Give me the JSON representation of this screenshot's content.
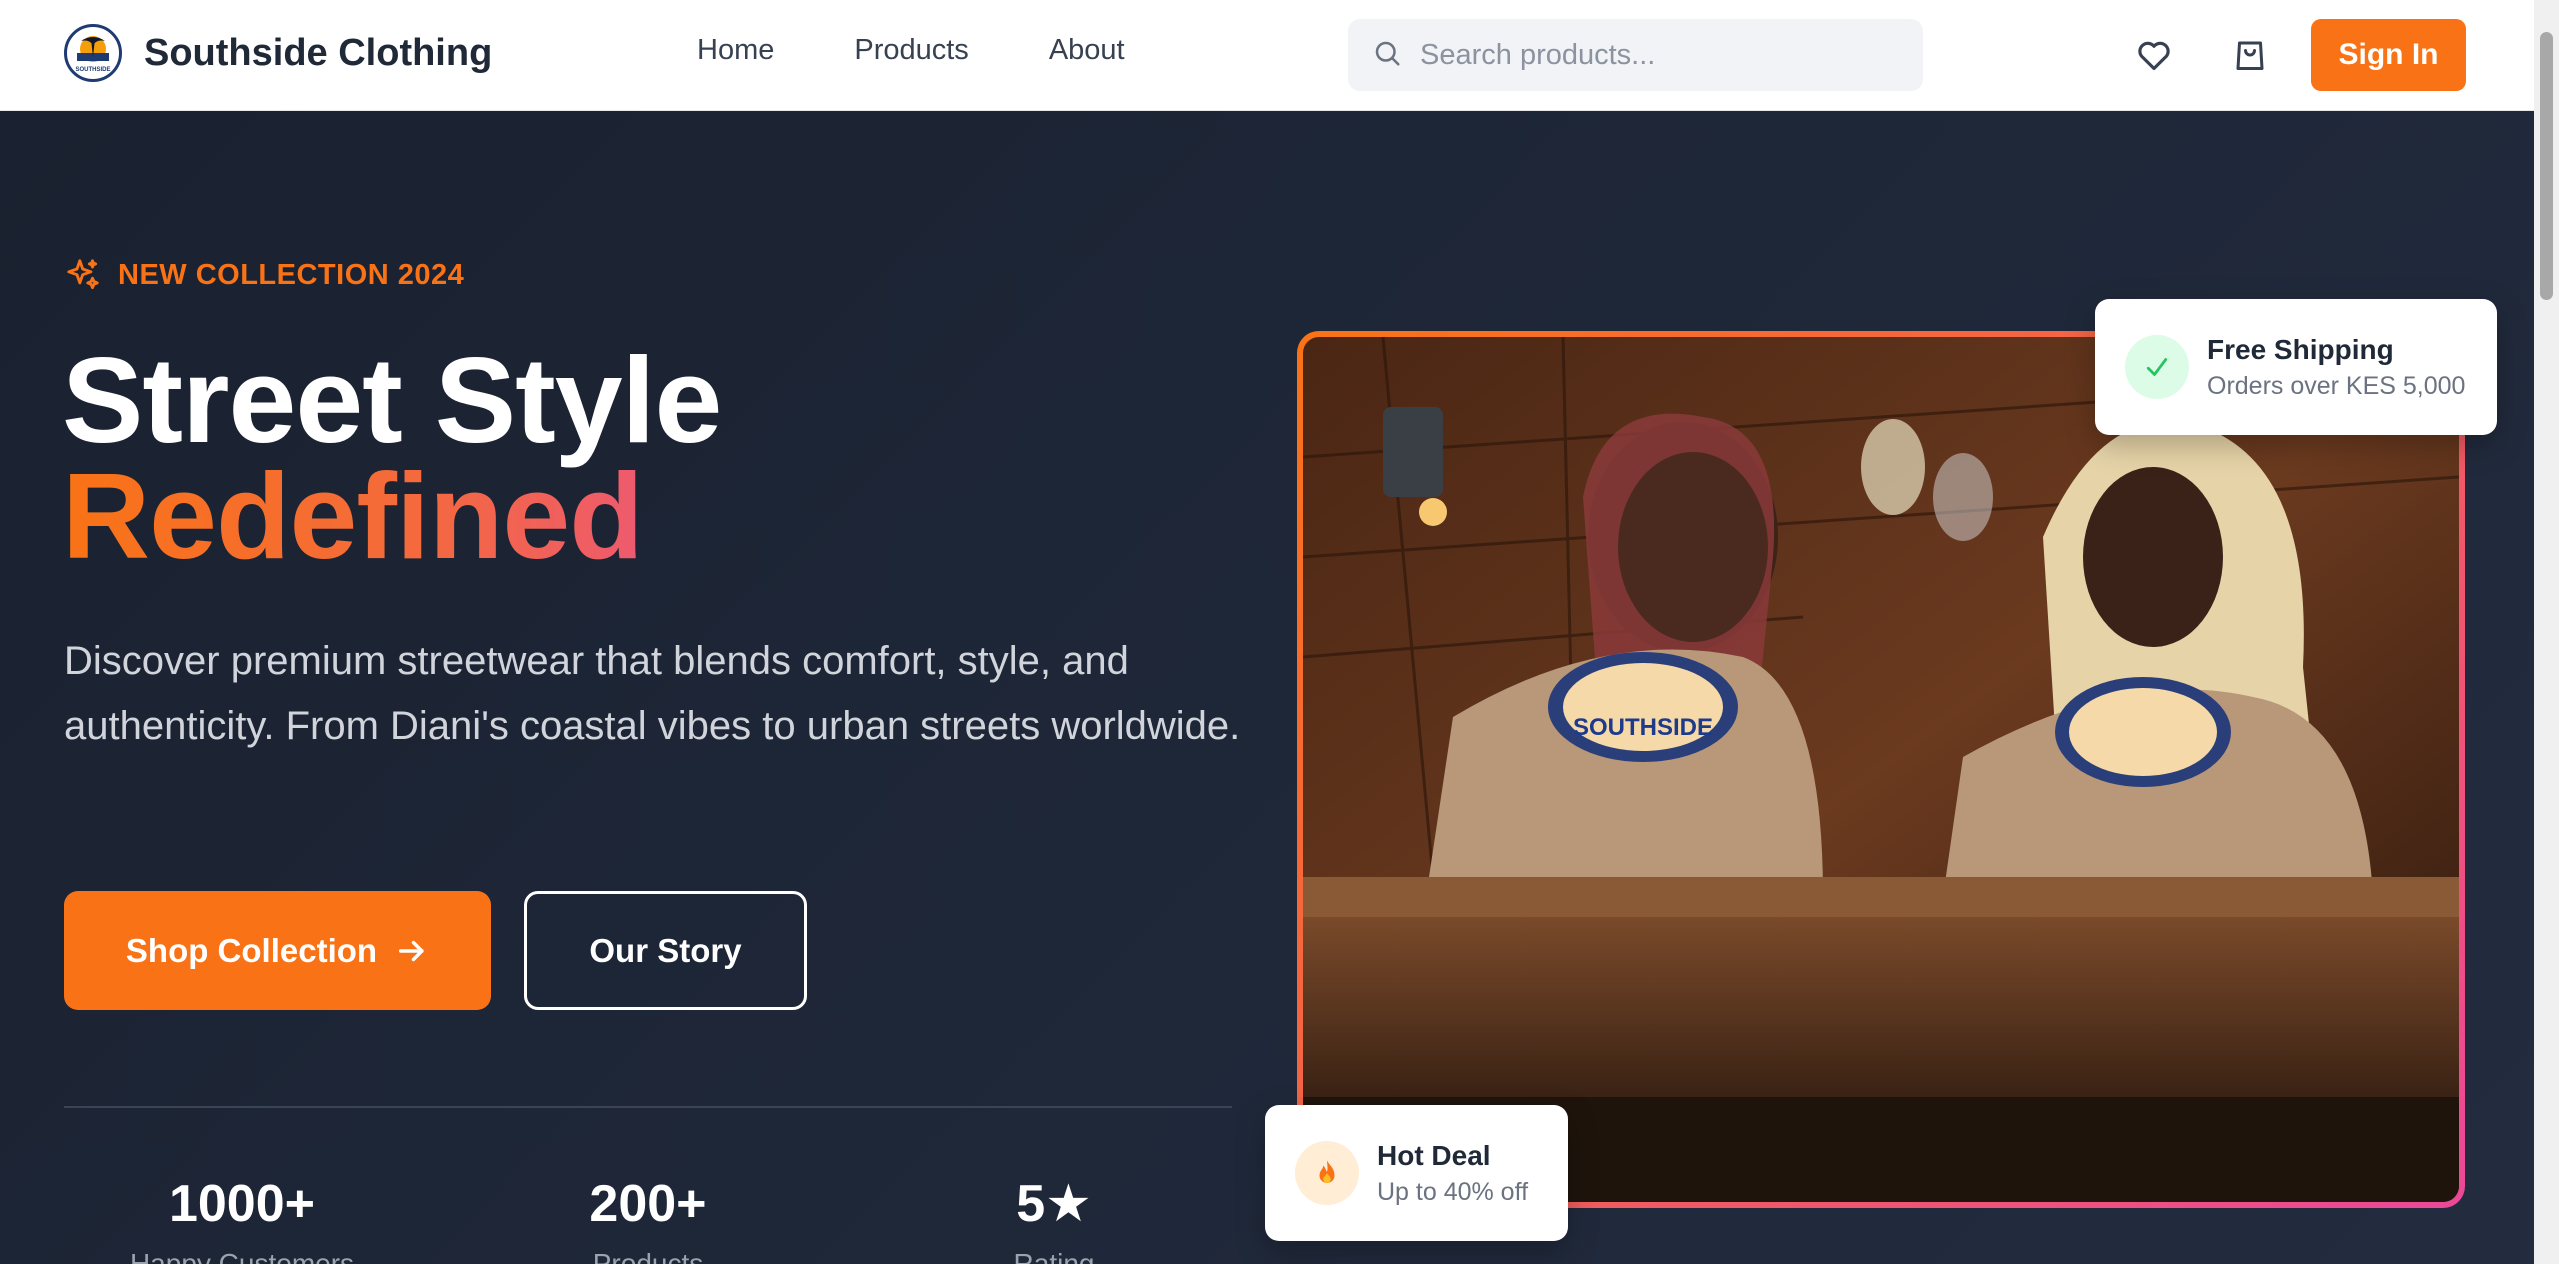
{
  "navbar": {
    "brand_name": "Southside Clothing",
    "logo_text": "SOUTHSIDE",
    "links": [
      {
        "label": "Home"
      },
      {
        "label": "Products"
      },
      {
        "label": "About"
      }
    ],
    "search": {
      "placeholder": "Search products...",
      "value": "",
      "icon": "search-icon"
    },
    "wishlist_icon": "heart-icon",
    "cart_icon": "shopping-bag-icon",
    "sign_in_label": "Sign In"
  },
  "hero": {
    "tagline": "NEW COLLECTION 2024",
    "tagline_icon": "sparkles-icon",
    "headline_line1": "Street Style",
    "headline_line2": "Redefined",
    "description": "Discover premium streetwear that blends comfort, style, and authenticity. From Diani's coastal vibes to urban streets worldwide.",
    "primary_button": "Shop Collection",
    "secondary_button": "Our Story",
    "stats": [
      {
        "value": "1000+",
        "label": "Happy Customers"
      },
      {
        "value": "200+",
        "label": "Products"
      },
      {
        "value": "5★",
        "label": "Rating"
      }
    ],
    "photo_shirt_text": "SOUTHSIDE"
  },
  "cards": {
    "shipping": {
      "title": "Free Shipping",
      "subtitle": "Orders over KES 5,000",
      "icon": "check-icon"
    },
    "deal": {
      "title": "Hot Deal",
      "subtitle": "Up to 40% off",
      "icon": "fire-icon"
    }
  },
  "colors": {
    "accent": "#f97316",
    "accent_pink": "#ec4899",
    "hero_bg": "#1e2533",
    "success_green": "#22c55e"
  }
}
